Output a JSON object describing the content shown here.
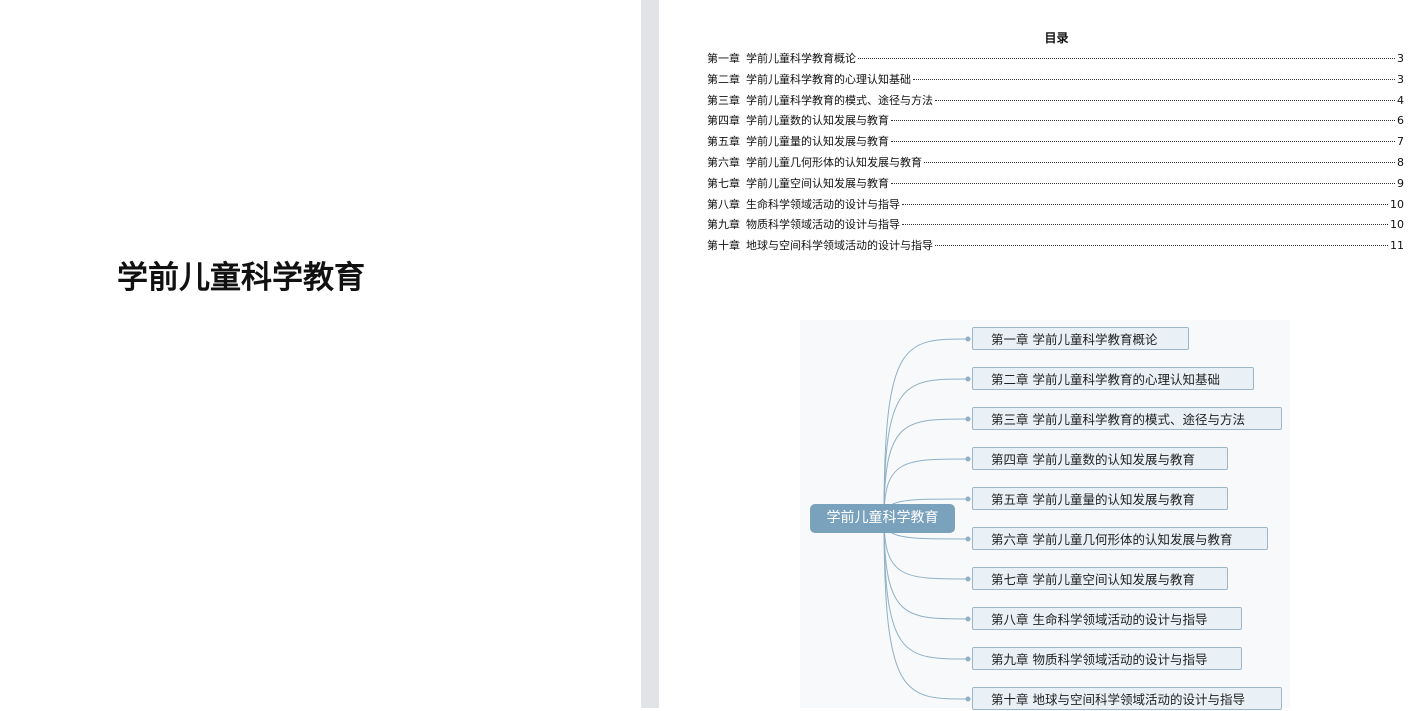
{
  "left_page": {
    "title": "学前儿童科学教育"
  },
  "toc": {
    "heading": "目录",
    "entries": [
      {
        "chapter": "第一章",
        "title": "学前儿童科学教育概论",
        "page": "3"
      },
      {
        "chapter": "第二章",
        "title": "学前儿童科学教育的心理认知基础",
        "page": "3"
      },
      {
        "chapter": "第三章",
        "title": "学前儿童科学教育的模式、途径与方法",
        "page": "4"
      },
      {
        "chapter": "第四章",
        "title": "学前儿童数的认知发展与教育",
        "page": "6"
      },
      {
        "chapter": "第五章",
        "title": "学前儿童量的认知发展与教育",
        "page": "7"
      },
      {
        "chapter": "第六章",
        "title": "学前儿童几何形体的认知发展与教育",
        "page": "8"
      },
      {
        "chapter": "第七章",
        "title": "学前儿童空间认知发展与教育",
        "page": "9"
      },
      {
        "chapter": "第八章",
        "title": "生命科学领域活动的设计与指导",
        "page": "10"
      },
      {
        "chapter": "第九章",
        "title": "物质科学领域活动的设计与指导",
        "page": "10"
      },
      {
        "chapter": "第十章",
        "title": "地球与空间科学领域活动的设计与指导",
        "page": "11"
      }
    ]
  },
  "mindmap": {
    "root": "学前儿童科学教育",
    "nodes": [
      "第一章 学前儿童科学教育概论",
      "第二章 学前儿童科学教育的心理认知基础",
      "第三章 学前儿童科学教育的模式、途径与方法",
      "第四章 学前儿童数的认知发展与教育",
      "第五章 学前儿童量的认知发展与教育",
      "第六章 学前儿童几何形体的认知发展与教育",
      "第七章 学前儿童空间认知发展与教育",
      "第八章 生命科学领域活动的设计与指导",
      "第九章 物质科学领域活动的设计与指导",
      "第十章 地球与空间科学领域活动的设计与指导"
    ],
    "colors": {
      "root_fill": "#7aa2bd",
      "node_fill": "#eaf1f6",
      "node_border": "#9fb6c7",
      "connector": "#8fb0c6"
    }
  }
}
